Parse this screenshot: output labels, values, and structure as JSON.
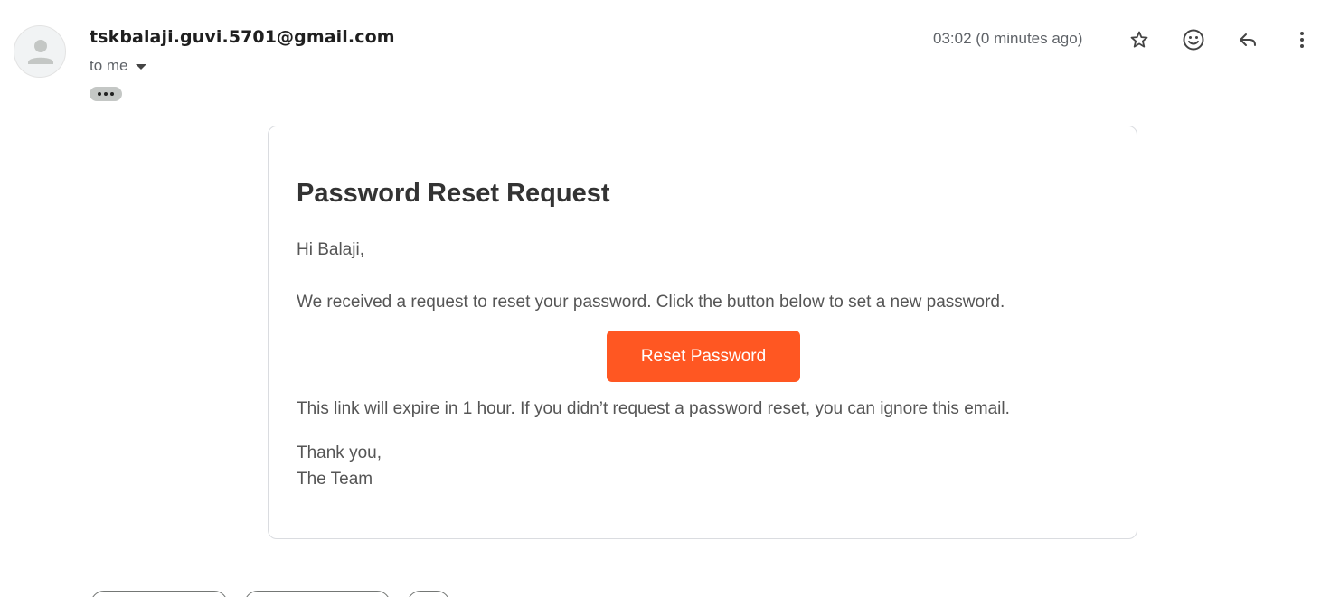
{
  "email": {
    "sender": "tskbalaji.guvi.5701@gmail.com",
    "recipient_label": "to me",
    "timestamp": "03:02 (0 minutes ago)"
  },
  "toolbar": {
    "icons": [
      "star-icon",
      "emoji-icon",
      "reply-icon",
      "more-vert-icon"
    ]
  },
  "message": {
    "title": "Password Reset Request",
    "greeting": "Hi Balaji,",
    "body_intro": "We received a request to reset your password. Click the button below to set a new password.",
    "button_label": "Reset Password",
    "body_expiry": "This link will expire in 1 hour. If you didn’t request a password reset, you can ignore this email.",
    "signoff": "Thank you,",
    "signature": "The Team"
  },
  "colors": {
    "accent": "#ff5722",
    "card_border": "#dadce0",
    "muted_text": "#5f6368"
  }
}
